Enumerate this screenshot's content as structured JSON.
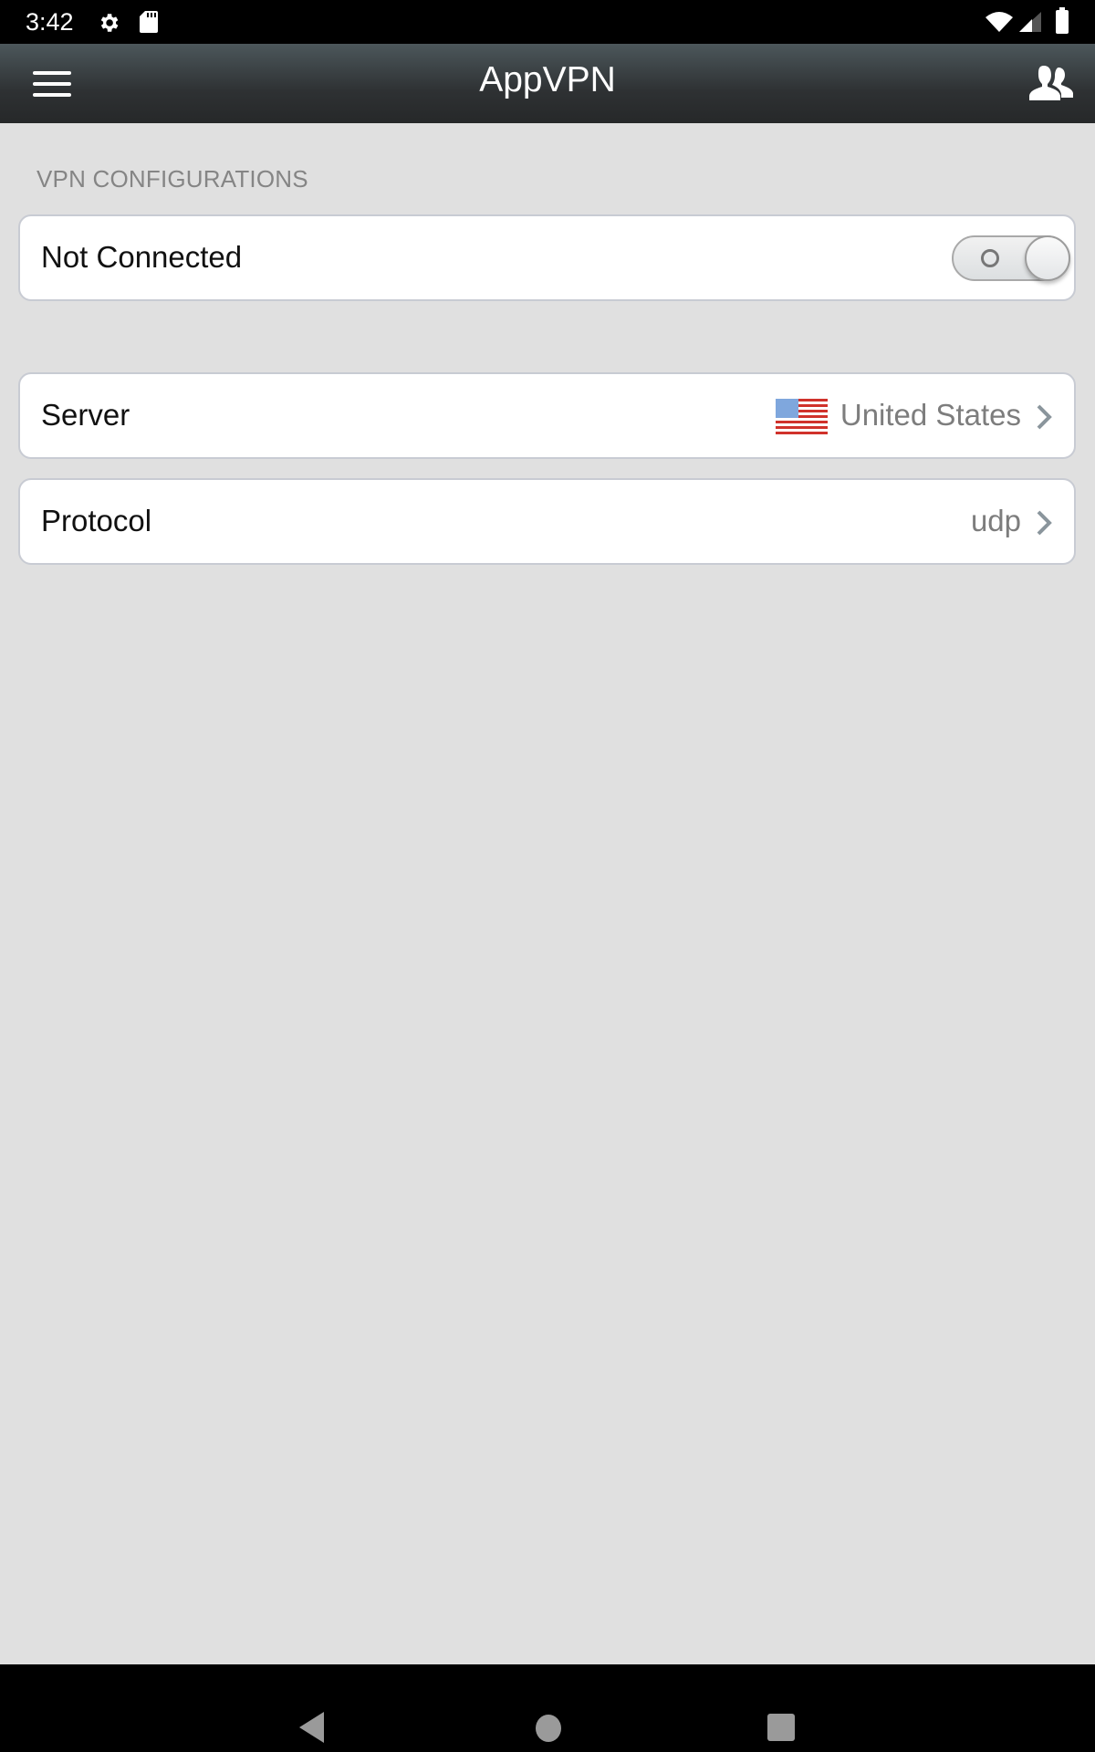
{
  "status_bar": {
    "time": "3:42",
    "icons": [
      "settings-icon",
      "sd-card-icon",
      "wifi-icon",
      "cell-signal-icon",
      "battery-icon"
    ]
  },
  "header": {
    "title": "AppVPN",
    "left_icon": "hamburger-menu-icon",
    "right_icon": "users-icon"
  },
  "section": {
    "label": "VPN CONFIGURATIONS"
  },
  "connection": {
    "status_label": "Not Connected",
    "toggle_on": false
  },
  "settings": [
    {
      "label": "Server",
      "value": "United States",
      "icon": "us-flag-icon"
    },
    {
      "label": "Protocol",
      "value": "udp"
    }
  ],
  "nav_bar": {
    "buttons": [
      "back",
      "home",
      "recents"
    ]
  }
}
